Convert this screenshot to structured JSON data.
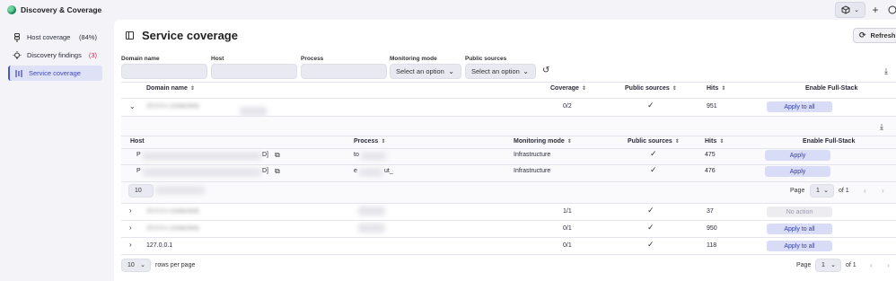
{
  "app": {
    "title": "Discovery & Coverage"
  },
  "sidebar": {
    "items": [
      {
        "label": "Host coverage",
        "count": "(84%)"
      },
      {
        "label": "Discovery findings",
        "count": "(3)"
      },
      {
        "label": "Service coverage",
        "count": ""
      }
    ]
  },
  "page": {
    "title": "Service coverage",
    "refresh_label": "Refresh"
  },
  "filters": {
    "domain_label": "Domain name",
    "host_label": "Host",
    "process_label": "Process",
    "monitoring_label": "Monitoring mode",
    "public_label": "Public sources",
    "monitoring_value": "Select an option",
    "public_value": "Select an option"
  },
  "table": {
    "headers": {
      "domain": "Domain name",
      "coverage": "Coverage",
      "public": "Public sources",
      "hits": "Hits",
      "enable": "Enable Full-Stack"
    },
    "rows": [
      {
        "domain": "10.0.0.x (redacted)",
        "coverage": "0/2",
        "hits": "951",
        "action": "Apply to all"
      },
      {
        "domain": "10.0.0.x (redacted)",
        "coverage": "1/1",
        "hits": "37",
        "action": "No action"
      },
      {
        "domain": "10.0.0.x (redacted)",
        "coverage": "0/1",
        "hits": "950",
        "action": "Apply to all"
      },
      {
        "domain": "127.0.0.1",
        "coverage": "0/1",
        "hits": "118",
        "action": "Apply to all"
      }
    ]
  },
  "nested": {
    "headers": {
      "host": "Host",
      "process": "Process",
      "monitoring": "Monitoring mode",
      "public": "Public sources",
      "hits": "Hits",
      "enable": "Enable Full-Stack"
    },
    "rows": [
      {
        "host_prefix": "P",
        "host_suffix": "D]",
        "process": "to",
        "monitoring": "Infrastructure",
        "hits": "475",
        "action": "Apply"
      },
      {
        "host_prefix": "P",
        "host_suffix": "D]",
        "process": "e",
        "process_suffix": "ut_",
        "monitoring": "Infrastructure",
        "hits": "476",
        "action": "Apply"
      }
    ],
    "page_size": "10",
    "page_label": "Page",
    "page_value": "1",
    "of_label": "of 1"
  },
  "pager": {
    "page_size": "10",
    "rows_per_page": "rows per page",
    "page_label": "Page",
    "page_value": "1",
    "of_label": "of 1"
  }
}
